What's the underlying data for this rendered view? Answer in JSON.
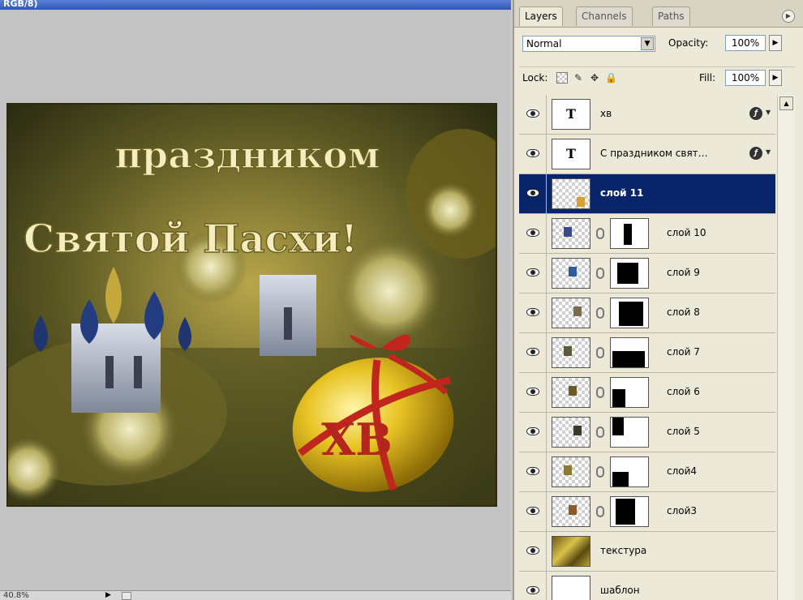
{
  "document": {
    "title": "RGB/8)",
    "zoom": "40.8%"
  },
  "canvas": {
    "headline_1": "праздником",
    "headline_2": "Святой Пасхи!",
    "egg_text": "ХВ"
  },
  "palette": {
    "tabs": [
      "Layers",
      "Channels",
      "Paths"
    ],
    "blend_mode": "Normal",
    "opacity_label": "Opacity:",
    "opacity": "100%",
    "lock_label": "Lock:",
    "fill_label": "Fill:",
    "fill": "100%"
  },
  "layers": [
    {
      "name": "хв",
      "type": "text",
      "fx": true
    },
    {
      "name": "С праздником свят…",
      "type": "text",
      "fx": true
    },
    {
      "name": "слой 11",
      "type": "pixel",
      "selected": true
    },
    {
      "name": "слой 10",
      "type": "masked"
    },
    {
      "name": "слой 9",
      "type": "masked"
    },
    {
      "name": "слой 8",
      "type": "masked"
    },
    {
      "name": "слой 7",
      "type": "masked"
    },
    {
      "name": "слой 6",
      "type": "masked"
    },
    {
      "name": "слой 5",
      "type": "masked"
    },
    {
      "name": "слой4",
      "type": "masked"
    },
    {
      "name": "слой3",
      "type": "masked"
    },
    {
      "name": "текстура",
      "type": "texture"
    },
    {
      "name": "шаблон",
      "type": "white"
    }
  ],
  "icons": {
    "eye": "eye-icon",
    "link": "chain-link-icon",
    "fx": "layer-style-fx-icon"
  },
  "colors": {
    "selection": "#0a246a",
    "panel": "#ece9d8",
    "titlebar": "#2f56b4"
  }
}
